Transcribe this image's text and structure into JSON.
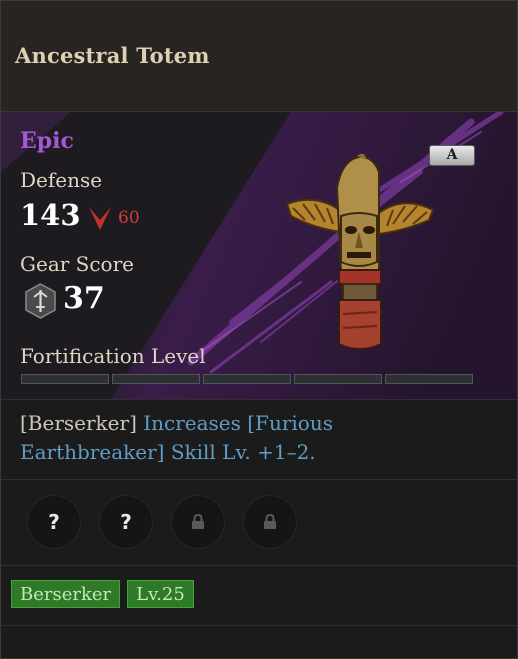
{
  "item": {
    "name": "Ancestral Totem",
    "rarity": "Epic",
    "rarity_color": "#a458d6",
    "grade": "A",
    "image_icon": "totem-icon"
  },
  "stats": {
    "defense_label": "Defense",
    "defense_value": "143",
    "defense_change": "60",
    "defense_change_direction": "down",
    "gear_score_label": "Gear Score",
    "gear_score_value": "37",
    "gear_score_icon": "sword-shield-icon"
  },
  "fortification": {
    "label": "Fortification Level",
    "filled": 0,
    "total": 5
  },
  "description": {
    "prefix": "[Berserker]",
    "highlight_1": "Increases [Furious",
    "highlight_2": "Earthbreaker]",
    "rest": "Skill Lv. +1–2."
  },
  "sockets": [
    {
      "icon": "question-icon",
      "text": "?"
    },
    {
      "icon": "question-icon",
      "text": "?"
    },
    {
      "icon": "lock-icon"
    },
    {
      "icon": "lock-icon"
    }
  ],
  "tags": [
    "Berserker",
    "Lv.25"
  ],
  "colors": {
    "highlight": "#5f9dc6",
    "decrease": "#d03e36",
    "tag_bg": "#2e7a26"
  }
}
